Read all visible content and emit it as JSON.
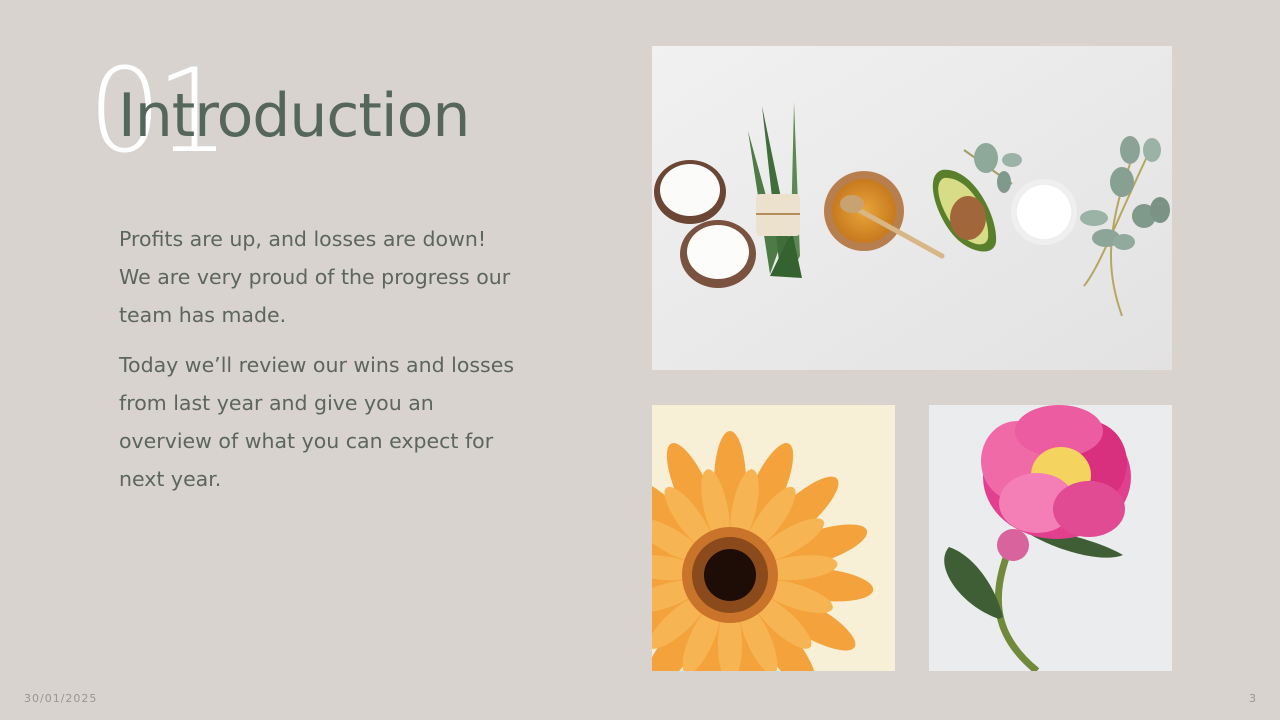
{
  "slide": {
    "number": "01",
    "title": "Introduction",
    "paragraphs": [
      "Profits are up, and losses are down! We are very proud of the progress our team has made.",
      "Today we’ll review our wins and losses from last year and give you an overview of what you can expect for next year."
    ],
    "footer": {
      "date": "30/01/2025",
      "page": "3"
    }
  },
  "images": {
    "top": "natural-ingredients-flatlay",
    "bottom_left": "orange-gerbera-flower",
    "bottom_right": "pink-peony-flower"
  },
  "colors": {
    "background": "#d8d3ce",
    "title": "#55675c",
    "number": "#ffffff",
    "body_text": "#5d6560",
    "footer_text": "#9a9590"
  }
}
